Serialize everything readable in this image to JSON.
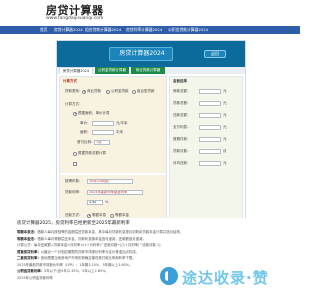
{
  "site": {
    "title": "房贷计算器",
    "url": "www.fangdaijisuanqi.com"
  },
  "nav": [
    "首页",
    "房贷计算器2024",
    "组合贷款计算器2024",
    "房贷利率计算器2024",
    "公积金贷款计算器2024"
  ],
  "calculator": {
    "title": "房贷计算器2024",
    "back_label": "返回",
    "tabs": [
      "房贷计算器2024",
      "公积金贷款计算器",
      "商业贷款计算器"
    ],
    "form": {
      "calc_type_label": "计算方式",
      "loan_type_label": "贷款类别：",
      "loan_type_options": [
        "商业贷款",
        "公积金贷款",
        "组合型贷款"
      ],
      "calc_by_label": "计算方式：",
      "by_area": "根据面积、单价计算",
      "unit_price_label": "单价：",
      "unit_price_unit": "元/平米",
      "area_label": "面积：",
      "area_unit": "平米",
      "down_payment_label": "首付比例：",
      "down_payment_value": "7成",
      "by_total": "根据贷款总额计算",
      "term_label": "按揭年数：",
      "term_value": "20年(240期)",
      "rate_label": "贷款利率：",
      "rate_value": "2024年最新利率基准利率",
      "rate_number": "4.90",
      "rate_unit": "%",
      "repay_label": "还款方式：",
      "repay_options": [
        "等额本息",
        "等额本金"
      ],
      "calc_button": "开始计算",
      "reset_button": "重新填写"
    },
    "results": {
      "heading": "查看结果",
      "rows": [
        {
          "label": "房款总额：",
          "unit": "元"
        },
        {
          "label": "贷款总额：",
          "unit": "元"
        },
        {
          "label": "还款总额：",
          "unit": "元"
        },
        {
          "label": "支付利息：",
          "unit": "元"
        },
        {
          "label": "首期付款：",
          "unit": "元"
        },
        {
          "label": "贷款月数：",
          "unit": "月"
        },
        {
          "label": "月均还款：",
          "unit": "元"
        }
      ]
    }
  },
  "article": {
    "title": "房贷计算器2025，房贷利率已经更新至2025年最新利率",
    "lines": [
      {
        "bold": "等额本息法：",
        "text": "借款人每月按相等的金额偿还贷款本息，其中每月贷款利息按月初剩余贷款本金计算并逐月结清。"
      },
      {
        "bold": "等额本金法：",
        "text": "借款人每月等额偿还本金，贷款利息随本金逐月递减，还款额逐月递减。"
      },
      {
        "bold": "",
        "text": "计算公式：每月还款额=贷款本金×月利率×(1+月利率)^还款月数÷[(1+月利率)^还款月数-1]"
      },
      {
        "bold": "首套房贷利率：",
        "text": "以最近一个月相应期限的贷款市场报价利率为定价基准加点形成。"
      },
      {
        "bold": "二套房贷利率：",
        "text": "各地根据当地房地产市场形势确定最低首付款比例和利率下限。"
      },
      {
        "bold": "",
        "text": "2025年最新贷款市场报价利率（LPR）：1年期3.10%，5年期以上3.60%。"
      },
      {
        "bold": "公积金贷款利率：",
        "text": "5年以下(含5年)2.35%，5年以上2.85%。"
      },
      {
        "bold": "",
        "text": "2025年公积金贷款利率"
      }
    ]
  },
  "watermark": "途达收录·赞"
}
